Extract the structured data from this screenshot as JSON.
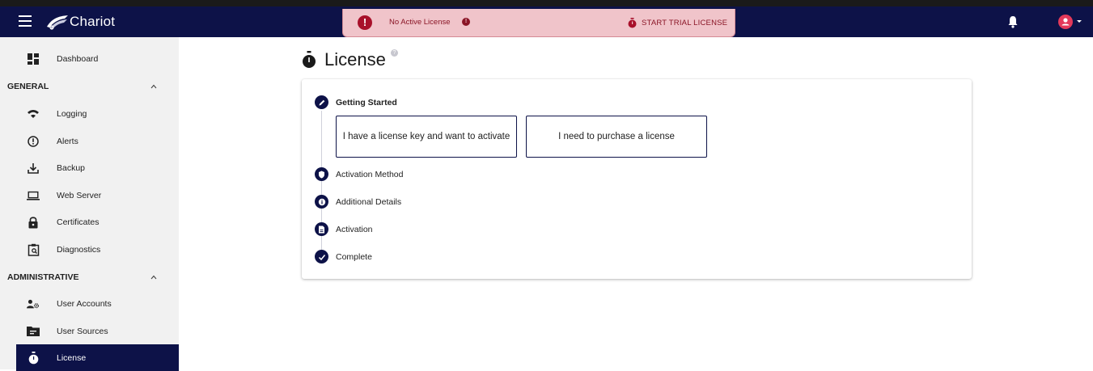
{
  "app": {
    "name": "Chariot"
  },
  "banner": {
    "status_text": "No Active License",
    "trial_button_label": "START TRIAL LICENSE",
    "colors": {
      "background": "#f0c4ca",
      "text": "#8a1526",
      "alert": "#a8102a"
    }
  },
  "header": {
    "icons": [
      "menu-icon",
      "chariot-logo",
      "bell-icon",
      "account-icon"
    ]
  },
  "sidebar": {
    "dashboard": "Dashboard",
    "general": {
      "label": "GENERAL",
      "items": [
        "Logging",
        "Alerts",
        "Backup",
        "Web Server",
        "Certificates",
        "Diagnostics"
      ]
    },
    "administrative": {
      "label": "ADMINISTRATIVE",
      "items": [
        "User Accounts",
        "User Sources",
        "License"
      ]
    },
    "active_item": "License"
  },
  "main": {
    "title": "License",
    "steps": [
      "Getting Started",
      "Activation Method",
      "Additional Details",
      "Activation",
      "Complete"
    ],
    "current_step": "Getting Started",
    "choices": [
      "I have a license key and want to activate",
      "I need to purchase a license"
    ]
  },
  "colors": {
    "primary": "#0d1248",
    "sidebar_bg": "#f1f1f1",
    "account_avatar": "#e3395a"
  }
}
